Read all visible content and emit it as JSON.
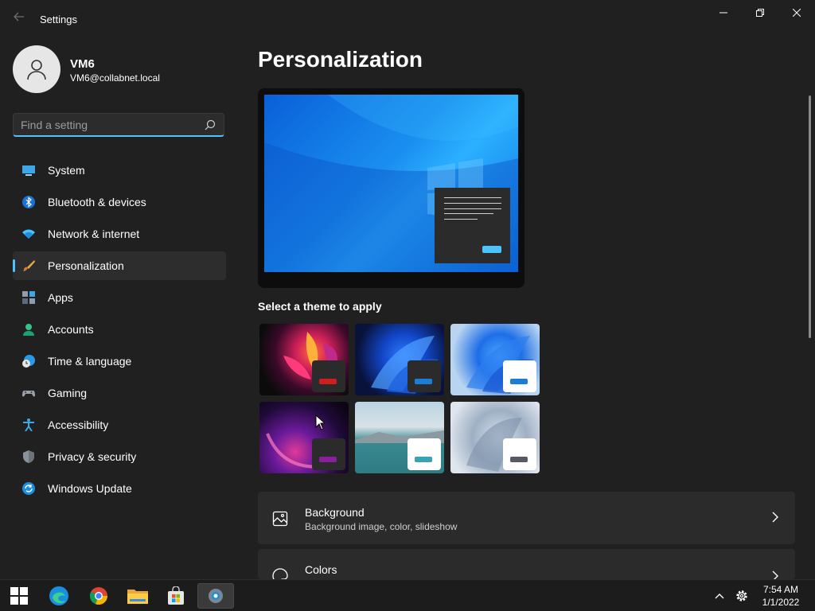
{
  "window": {
    "title": "Settings"
  },
  "user": {
    "name": "VM6",
    "email": "VM6@collabnet.local"
  },
  "search": {
    "placeholder": "Find a setting"
  },
  "nav": [
    {
      "label": "System",
      "icon": "monitor-icon"
    },
    {
      "label": "Bluetooth & devices",
      "icon": "bluetooth-icon"
    },
    {
      "label": "Network & internet",
      "icon": "wifi-icon"
    },
    {
      "label": "Personalization",
      "icon": "paintbrush-icon",
      "active": true
    },
    {
      "label": "Apps",
      "icon": "apps-icon"
    },
    {
      "label": "Accounts",
      "icon": "person-icon"
    },
    {
      "label": "Time & language",
      "icon": "clock-globe-icon"
    },
    {
      "label": "Gaming",
      "icon": "gamepad-icon"
    },
    {
      "label": "Accessibility",
      "icon": "accessibility-icon"
    },
    {
      "label": "Privacy & security",
      "icon": "shield-icon"
    },
    {
      "label": "Windows Update",
      "icon": "update-icon"
    }
  ],
  "main": {
    "title": "Personalization",
    "themes_heading": "Select a theme to apply",
    "themes": [
      {
        "name": "flower-dark",
        "bar_color": "#d01d1d"
      },
      {
        "name": "bloom-dark",
        "bar_color": "#1a7fd4"
      },
      {
        "name": "bloom-light",
        "bar_color": "#1a7fd4"
      },
      {
        "name": "glow-purple",
        "bar_color": "#8a1f9e"
      },
      {
        "name": "lake",
        "bar_color": "#3aa3b3"
      },
      {
        "name": "captured-motion",
        "bar_color": "#555a63"
      }
    ],
    "cards": [
      {
        "title": "Background",
        "subtitle": "Background image, color, slideshow",
        "icon": "image-icon"
      },
      {
        "title": "Colors",
        "subtitle": "",
        "icon": "palette-icon"
      }
    ]
  },
  "taskbar": {
    "time": "7:54 AM",
    "date": "1/1/2022",
    "apps": [
      "start-icon",
      "edge-icon",
      "chrome-icon",
      "file-explorer-icon",
      "store-icon",
      "settings-icon"
    ]
  },
  "colors": {
    "accent": "#4cc2ff",
    "background": "#202020",
    "card": "#2b2b2b"
  }
}
